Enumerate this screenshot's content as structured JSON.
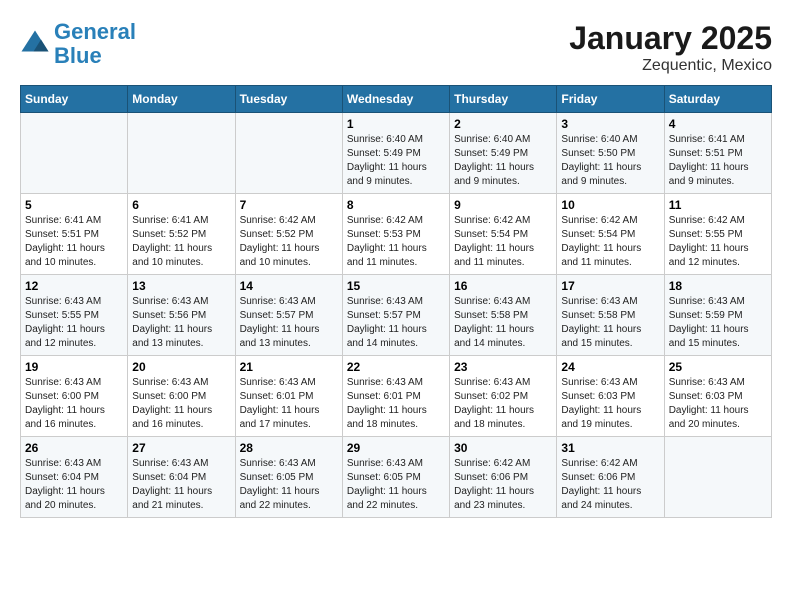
{
  "header": {
    "logo_line1": "General",
    "logo_line2": "Blue",
    "title": "January 2025",
    "subtitle": "Zequentic, Mexico"
  },
  "weekdays": [
    "Sunday",
    "Monday",
    "Tuesday",
    "Wednesday",
    "Thursday",
    "Friday",
    "Saturday"
  ],
  "weeks": [
    [
      {
        "day": "",
        "info": ""
      },
      {
        "day": "",
        "info": ""
      },
      {
        "day": "",
        "info": ""
      },
      {
        "day": "1",
        "info": "Sunrise: 6:40 AM\nSunset: 5:49 PM\nDaylight: 11 hours and 9 minutes."
      },
      {
        "day": "2",
        "info": "Sunrise: 6:40 AM\nSunset: 5:49 PM\nDaylight: 11 hours and 9 minutes."
      },
      {
        "day": "3",
        "info": "Sunrise: 6:40 AM\nSunset: 5:50 PM\nDaylight: 11 hours and 9 minutes."
      },
      {
        "day": "4",
        "info": "Sunrise: 6:41 AM\nSunset: 5:51 PM\nDaylight: 11 hours and 9 minutes."
      }
    ],
    [
      {
        "day": "5",
        "info": "Sunrise: 6:41 AM\nSunset: 5:51 PM\nDaylight: 11 hours and 10 minutes."
      },
      {
        "day": "6",
        "info": "Sunrise: 6:41 AM\nSunset: 5:52 PM\nDaylight: 11 hours and 10 minutes."
      },
      {
        "day": "7",
        "info": "Sunrise: 6:42 AM\nSunset: 5:52 PM\nDaylight: 11 hours and 10 minutes."
      },
      {
        "day": "8",
        "info": "Sunrise: 6:42 AM\nSunset: 5:53 PM\nDaylight: 11 hours and 11 minutes."
      },
      {
        "day": "9",
        "info": "Sunrise: 6:42 AM\nSunset: 5:54 PM\nDaylight: 11 hours and 11 minutes."
      },
      {
        "day": "10",
        "info": "Sunrise: 6:42 AM\nSunset: 5:54 PM\nDaylight: 11 hours and 11 minutes."
      },
      {
        "day": "11",
        "info": "Sunrise: 6:42 AM\nSunset: 5:55 PM\nDaylight: 11 hours and 12 minutes."
      }
    ],
    [
      {
        "day": "12",
        "info": "Sunrise: 6:43 AM\nSunset: 5:55 PM\nDaylight: 11 hours and 12 minutes."
      },
      {
        "day": "13",
        "info": "Sunrise: 6:43 AM\nSunset: 5:56 PM\nDaylight: 11 hours and 13 minutes."
      },
      {
        "day": "14",
        "info": "Sunrise: 6:43 AM\nSunset: 5:57 PM\nDaylight: 11 hours and 13 minutes."
      },
      {
        "day": "15",
        "info": "Sunrise: 6:43 AM\nSunset: 5:57 PM\nDaylight: 11 hours and 14 minutes."
      },
      {
        "day": "16",
        "info": "Sunrise: 6:43 AM\nSunset: 5:58 PM\nDaylight: 11 hours and 14 minutes."
      },
      {
        "day": "17",
        "info": "Sunrise: 6:43 AM\nSunset: 5:58 PM\nDaylight: 11 hours and 15 minutes."
      },
      {
        "day": "18",
        "info": "Sunrise: 6:43 AM\nSunset: 5:59 PM\nDaylight: 11 hours and 15 minutes."
      }
    ],
    [
      {
        "day": "19",
        "info": "Sunrise: 6:43 AM\nSunset: 6:00 PM\nDaylight: 11 hours and 16 minutes."
      },
      {
        "day": "20",
        "info": "Sunrise: 6:43 AM\nSunset: 6:00 PM\nDaylight: 11 hours and 16 minutes."
      },
      {
        "day": "21",
        "info": "Sunrise: 6:43 AM\nSunset: 6:01 PM\nDaylight: 11 hours and 17 minutes."
      },
      {
        "day": "22",
        "info": "Sunrise: 6:43 AM\nSunset: 6:01 PM\nDaylight: 11 hours and 18 minutes."
      },
      {
        "day": "23",
        "info": "Sunrise: 6:43 AM\nSunset: 6:02 PM\nDaylight: 11 hours and 18 minutes."
      },
      {
        "day": "24",
        "info": "Sunrise: 6:43 AM\nSunset: 6:03 PM\nDaylight: 11 hours and 19 minutes."
      },
      {
        "day": "25",
        "info": "Sunrise: 6:43 AM\nSunset: 6:03 PM\nDaylight: 11 hours and 20 minutes."
      }
    ],
    [
      {
        "day": "26",
        "info": "Sunrise: 6:43 AM\nSunset: 6:04 PM\nDaylight: 11 hours and 20 minutes."
      },
      {
        "day": "27",
        "info": "Sunrise: 6:43 AM\nSunset: 6:04 PM\nDaylight: 11 hours and 21 minutes."
      },
      {
        "day": "28",
        "info": "Sunrise: 6:43 AM\nSunset: 6:05 PM\nDaylight: 11 hours and 22 minutes."
      },
      {
        "day": "29",
        "info": "Sunrise: 6:43 AM\nSunset: 6:05 PM\nDaylight: 11 hours and 22 minutes."
      },
      {
        "day": "30",
        "info": "Sunrise: 6:42 AM\nSunset: 6:06 PM\nDaylight: 11 hours and 23 minutes."
      },
      {
        "day": "31",
        "info": "Sunrise: 6:42 AM\nSunset: 6:06 PM\nDaylight: 11 hours and 24 minutes."
      },
      {
        "day": "",
        "info": ""
      }
    ]
  ]
}
